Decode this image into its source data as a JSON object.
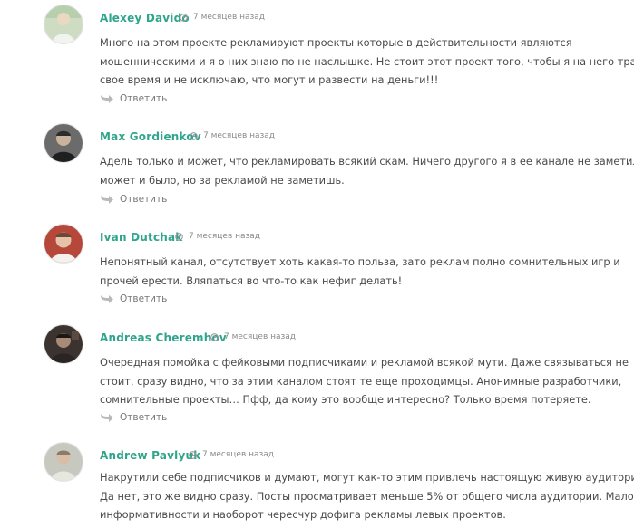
{
  "comments": [
    {
      "author": "Alexey Davido",
      "time": "7 месяцев назад",
      "lines": [
        "Много на этом проекте рекламируют проекты которые в действительности являются",
        "мошенническими и я о них знаю по не наслышке. Не стоит этот проект того, чтобы я на него тратил",
        "свое время и не исключаю, что могут и развести на деньги!!!"
      ],
      "reply_label": "Ответить"
    },
    {
      "author": "Max Gordienkov",
      "time": "7 месяцев назад",
      "lines": [
        "Адель только и может, что рекламировать всякий скам. Ничего другого я в ее канале не заметил.",
        "может и было, но за рекламой не заметишь."
      ],
      "reply_label": "Ответить"
    },
    {
      "author": "Ivan Dutchak",
      "time": "7 месяцев назад",
      "lines": [
        "Непонятный канал, отсутствует хоть какая-то польза, зато реклам полно сомнительных игр и",
        "прочей ерести. Вляпаться во что-то как нефиг делать!"
      ],
      "reply_label": "Ответить"
    },
    {
      "author": "Andreas Cheremhov",
      "time": "7 месяцев назад",
      "lines": [
        "Очередная помойка с фейковыми подписчиками и рекламой всякой мути. Даже связываться не",
        "стоит, сразу видно, что за этим каналом стоят те еще проходимцы. Анонимные разработчики,",
        "сомнительные проекты… Пфф, да кому это вообще интересно? Только время потеряете."
      ],
      "reply_label": "Ответить"
    },
    {
      "author": "Andrew Pavlyuk",
      "time": "7 месяцев назад",
      "lines": [
        "Накрутили себе подписчиков и думают, могут как-то этим привлечь настоящую живую аудиторию.",
        "Да нет, это же видно сразу. Посты просматривает меньше 5% от общего числа аудитории. Мало",
        "информативности и наоборот чересчур дофига рекламы левых проектов."
      ]
    }
  ],
  "colors": {
    "author": "#2fa58c",
    "meta": "#8a8a8a",
    "text": "#4a4a4a",
    "reply": "#777777"
  },
  "icons": {
    "time": "clock-icon",
    "reply": "reply-arrow-icon"
  }
}
